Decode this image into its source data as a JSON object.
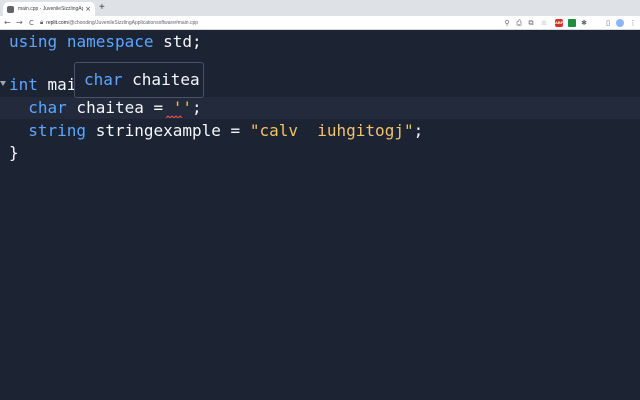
{
  "browser": {
    "tab": {
      "title": "main.cpp - JuvenileSizzlingAp...",
      "close_glyph": "×"
    },
    "new_tab_glyph": "+",
    "nav": {
      "back": "←",
      "forward": "→",
      "reload": "C"
    },
    "url": {
      "host": "replit.com",
      "path": "/@chooding/JuvenileSizzlingApplicationsoftware#main.cpp"
    },
    "toolbar_icons": [
      "search-icon",
      "share-icon",
      "open-in-tab-icon",
      "bookmark-star-icon",
      "extension-red-icon",
      "extension-green-icon",
      "puzzle-extensions-icon",
      "sidebar-icon",
      "profile-avatar-icon"
    ],
    "ext_red_label": "ABP",
    "colors": {
      "tabstrip": "#dee1e6",
      "toolbar": "#ffffff"
    }
  },
  "editor": {
    "colors": {
      "background": "#1c2333",
      "keyword": "#5ba7ff",
      "string": "#f4c267",
      "text": "#f5f9fc",
      "error": "#e5534b"
    },
    "line1": {
      "kw1": "using",
      "kw2": "namespace",
      "rest": " std;"
    },
    "line3": {
      "kw": "int",
      "rest": " mai"
    },
    "line4": {
      "indent": "  ",
      "kw": "char",
      "rest": " chaitea = ",
      "literal": "''",
      "end": ";"
    },
    "line5": {
      "indent": "  ",
      "kw": "string",
      "rest": " stringexample = ",
      "literal": "\"calv  iuhgitogj\"",
      "end": ";"
    },
    "line6": {
      "text": "}"
    },
    "tooltip": {
      "kw": "char",
      "rest": " chaitea"
    }
  }
}
